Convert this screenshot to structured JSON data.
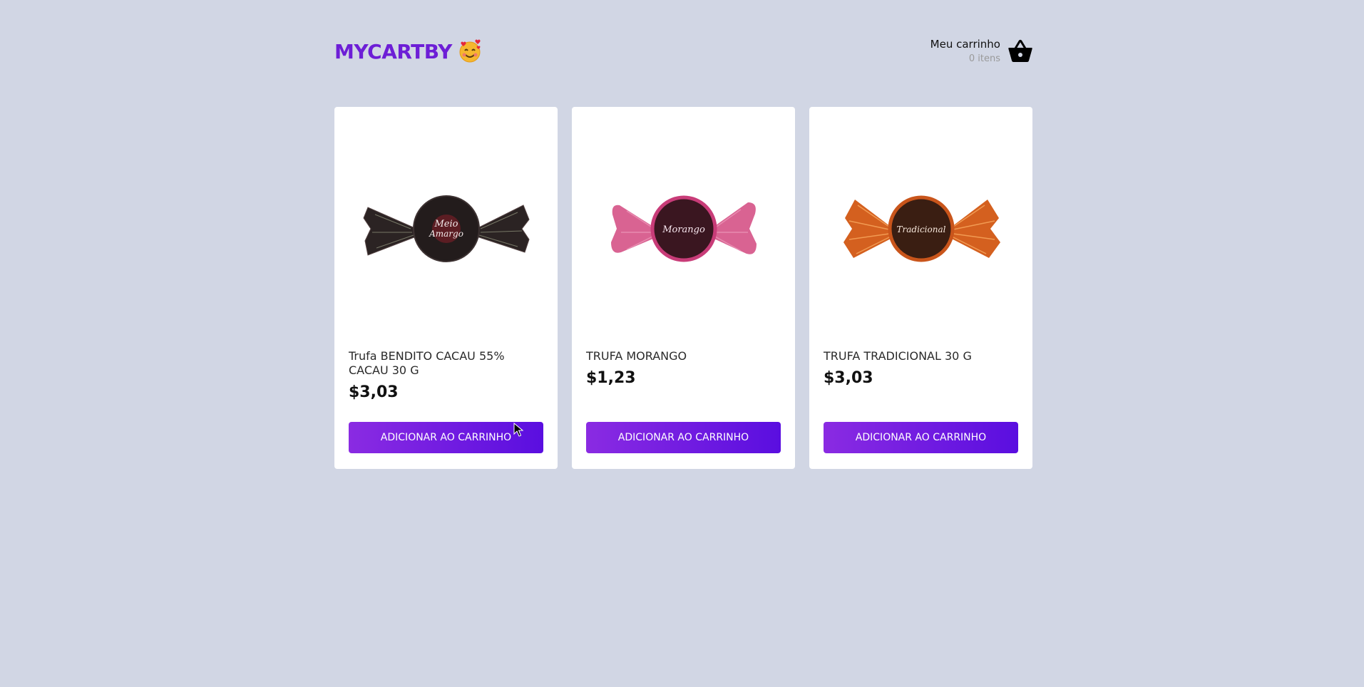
{
  "header": {
    "logo_text": "MYCARTBY",
    "logo_emoji_icon": "smiling-face-with-hearts-icon",
    "cart_label": "Meu carrinho",
    "cart_count": "0 itens",
    "cart_icon": "basket-icon"
  },
  "products": [
    {
      "name": "Trufa BENDITO CACAU 55% CACAU 30 G",
      "price": "$3,03",
      "button_label": "ADICIONAR AO CARRINHO",
      "image_icon": "truffle-meio-amargo-icon",
      "wrapper_color": "#2b2323",
      "label_text": "Meio Amargo"
    },
    {
      "name": "TRUFA MORANGO",
      "price": "$1,23",
      "button_label": "ADICIONAR AO CARRINHO",
      "image_icon": "truffle-morango-icon",
      "wrapper_color": "#c83c78",
      "label_text": "Morango"
    },
    {
      "name": "TRUFA TRADICIONAL 30 G",
      "price": "$3,03",
      "button_label": "ADICIONAR AO CARRINHO",
      "image_icon": "truffle-tradicional-icon",
      "wrapper_color": "#c9551b",
      "label_text": "Tradicional"
    }
  ],
  "colors": {
    "background": "#d1d6e4",
    "brand": "#6d1ed6",
    "button_start": "#8a2be2",
    "button_end": "#5a0ee0"
  }
}
